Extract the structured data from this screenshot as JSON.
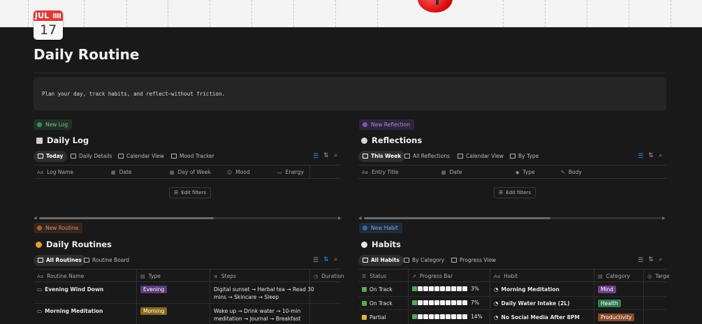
{
  "page": {
    "calendar_month": "JUL",
    "calendar_day": "17",
    "title": "Daily Routine",
    "description": "Plan your day, track habits, and reflect—without friction."
  },
  "daily_log": {
    "new_button": "New Log",
    "heading": "Daily Log",
    "tabs": [
      "Today",
      "Daily Details",
      "Calendar View",
      "Mood Tracker"
    ],
    "columns": [
      "Log Name",
      "Date",
      "Day of Week",
      "Mood",
      "Energy"
    ],
    "edit_filters": "Edit filters"
  },
  "reflections": {
    "new_button": "New Reflection",
    "heading": "Reflections",
    "tabs": [
      "This Week",
      "All Reflections",
      "Calendar View",
      "By Type"
    ],
    "columns": [
      "Entry Title",
      "Date",
      "Type",
      "Body"
    ],
    "edit_filters": "Edit filters"
  },
  "routines": {
    "new_button": "New Routine",
    "heading": "Daily Routines",
    "tabs": [
      "All Routines",
      "Routine Board"
    ],
    "columns": [
      "Routine Name",
      "Type",
      "Steps",
      "Duration"
    ],
    "rows": [
      {
        "name": "Evening Wind Down",
        "type": "Evening",
        "type_color": "#5a3a7a",
        "steps_1": "Digital sunset → Herbal tea → Read 30",
        "steps_2": "mins → Skincare → Sleep"
      },
      {
        "name": "Morning Meditation",
        "type": "Morning",
        "type_color": "#8a6418",
        "steps_1": "Wake up → Drink water → 10-min",
        "steps_2": "meditation → Journal → Breakfast"
      }
    ]
  },
  "habits": {
    "new_button": "New Habit",
    "heading": "Habits",
    "tabs": [
      "All Habits",
      "By Category",
      "Progress View"
    ],
    "columns": [
      "Status",
      "Progress Bar",
      "Habit",
      "Category",
      "Targe"
    ],
    "rows": [
      {
        "status": "On Track",
        "status_color": "#5aa84f",
        "progress_label": "3%",
        "progress": 0.03,
        "habit": "Morning Meditation",
        "category": "Mind",
        "category_color": "#6b3f8c"
      },
      {
        "status": "On Track",
        "status_color": "#5aa84f",
        "progress_label": "7%",
        "progress": 0.07,
        "habit": "Daily Water Intake (2L)",
        "category": "Health",
        "category_color": "#2f7a4f"
      },
      {
        "status": "Partial",
        "status_color": "#e0b43a",
        "progress_label": "14%",
        "progress": 0.14,
        "habit": "No Social Media After 8PM",
        "category": "Productivity",
        "category_color": "#8a4a2a"
      }
    ]
  }
}
